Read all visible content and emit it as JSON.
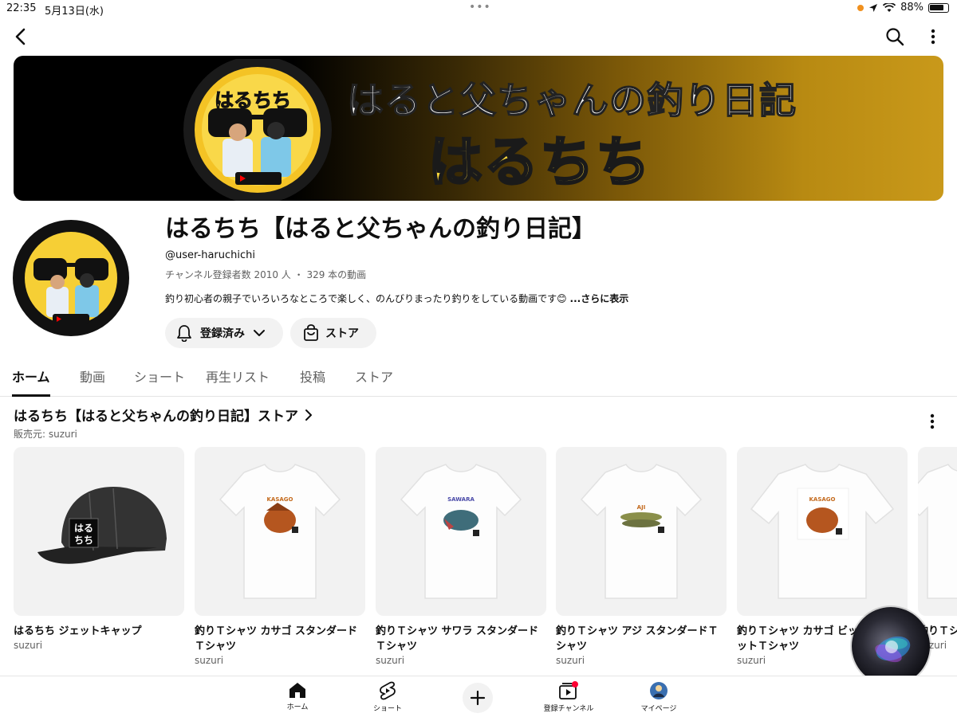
{
  "status_bar": {
    "time": "22:35",
    "date": "5月13日(水)",
    "battery": "88%"
  },
  "colors": {
    "accent": "#0f0f0f",
    "secondary_text": "#606060",
    "pill_bg": "#f2f2f2",
    "banner_gold": "#c9991a",
    "notification_red": "#ff0033"
  },
  "banner": {
    "logo_text": "はるちち",
    "title_line1": "はると父ちゃんの釣り日記",
    "title_line2": "はるちち"
  },
  "channel": {
    "name": "はるちち【はると父ちゃんの釣り日記】",
    "handle": "@user-haruchichi",
    "stats": "チャンネル登録者数 2010 人 ・ 329 本の動画",
    "description": "釣り初心者の親子でいろいろなところで楽しく、のんびりまったり釣りをしている動画です😊",
    "more_label": "...さらに表示",
    "subscribed_label": "登録済み",
    "store_label": "ストア"
  },
  "tabs": [
    {
      "label": "ホーム",
      "active": true
    },
    {
      "label": "動画"
    },
    {
      "label": "ショート"
    },
    {
      "label": "再生リスト"
    },
    {
      "label": "投稿"
    },
    {
      "label": "ストア"
    }
  ],
  "store_section": {
    "title": "はるちち【はると父ちゃんの釣り日記】ストア",
    "seller": "販売元: suzuri",
    "products": [
      {
        "name": "はるちち ジェットキャップ",
        "shop": "suzuri",
        "icon": "cap-image"
      },
      {
        "name": "釣りＴシャツ カサゴ スタンダードＴシャツ",
        "shop": "suzuri",
        "icon": "tshirt-kasago-image",
        "print_label": "KASAGO"
      },
      {
        "name": "釣りＴシャツ サワラ スタンダードＴシャツ",
        "shop": "suzuri",
        "icon": "tshirt-sawara-image",
        "print_label": "SAWARA"
      },
      {
        "name": "釣りＴシャツ アジ スタンダードＴシャツ",
        "shop": "suzuri",
        "icon": "tshirt-aji-image",
        "print_label": "AJI"
      },
      {
        "name": "釣りＴシャツ カサゴ ビッグシルエットＴシャツ",
        "shop": "suzuri",
        "icon": "tshirt-kasago-big-image",
        "print_label": "KASAGO"
      },
      {
        "name": "釣りＴシャツ",
        "shop": "suzuri",
        "icon": "tshirt-partial-image"
      }
    ]
  },
  "bottom_nav": {
    "home": "ホーム",
    "shorts": "ショート",
    "subscriptions": "登録チャンネル",
    "mypage": "マイページ"
  }
}
